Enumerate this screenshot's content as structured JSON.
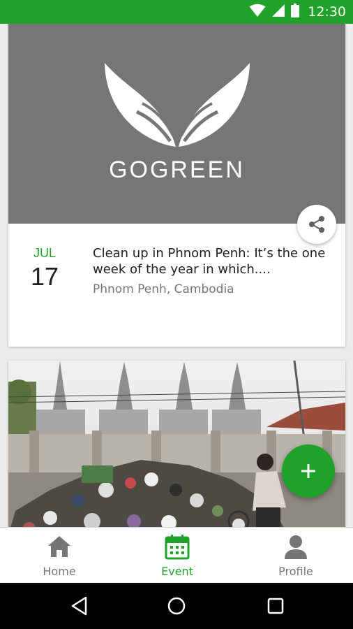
{
  "status_bar": {
    "time": "12:30",
    "icons": [
      "wifi-icon",
      "cell-signal-icon",
      "battery-icon"
    ]
  },
  "events": [
    {
      "image": "gogreen-logo",
      "logo_text": "GOGREEN",
      "month": "JUL",
      "day": "17",
      "title": "Clean up in Phnom Penh: It’s the one week of the year in which....",
      "location": "Phnom Penh, Cambodia",
      "share_icon": "share-icon"
    },
    {
      "image": "garbage-street-photo"
    }
  ],
  "fab": {
    "icon": "plus-icon"
  },
  "bottom_nav": {
    "items": [
      {
        "label": "Home",
        "icon": "home-icon",
        "active": false
      },
      {
        "label": "Event",
        "icon": "calendar-icon",
        "active": true
      },
      {
        "label": "Profile",
        "icon": "person-icon",
        "active": false
      }
    ]
  },
  "system_nav": {
    "buttons": [
      "back-icon",
      "home-circle-icon",
      "recent-apps-icon"
    ]
  },
  "colors": {
    "accent": "#1fa12a",
    "banner": "#767676",
    "text_primary": "#212121",
    "text_secondary": "#757575"
  }
}
